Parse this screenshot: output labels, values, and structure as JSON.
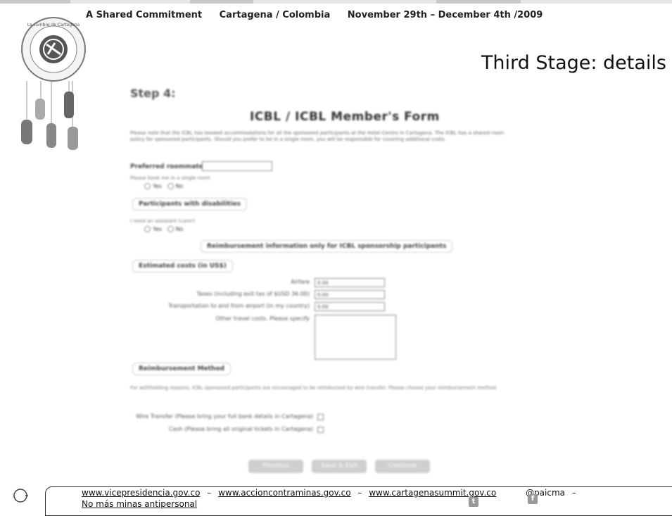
{
  "header": {
    "tagline": "A Shared Commitment",
    "location": "Cartagena / Colombia",
    "dates": "November 29th  – December 4th  /2009"
  },
  "slide": {
    "title": "Third Stage: details"
  },
  "logo": {
    "ring_text": "La cumbre de Cartagena por un mundo sin minas antipersonal"
  },
  "form": {
    "step": "Step 4:",
    "title": "ICBL / ICBL Member's Form",
    "intro": "Please note that the ICBL has booked accommodations for all the sponsored participants at the Hotel Centro in Cartagena. The ICBL has a shared room policy for sponsored participants. Should you prefer to be in a single room, you will be responsible for covering additional costs.",
    "preferred_roommate_label": "Preferred roommate",
    "single_room_question": "Please book me in a single room",
    "yes_label": "Yes",
    "no_label": "No",
    "disability_section": "Participants with disabilities",
    "assistant_question": "I need an assistant (carer)",
    "reimbursement_section": "Reimbursement information only for ICBL sponsorship participants",
    "estimated_costs_label": "Estimated costs (in US$)",
    "airfare_label": "Airfare",
    "taxes_label": "Taxes (including exit tax of $USD 36.00)",
    "transport_label": "Transportation to and from airport (in my country)",
    "other_costs_label": "Other travel costs. Please specify",
    "zero_value": "0.00",
    "method_section": "Reimbursement Method",
    "method_note": "For withholding reasons, ICBL sponsored participants are encouraged to be reimbursed by wire transfer. Please choose your reimbursement method",
    "wire_label": "Wire Transfer (Please bring your full bank details in Cartagena)",
    "cash_label": "Cash (Please bring all original tickets in Cartagena)",
    "buttons": [
      "Previous",
      "Save & Exit",
      "Continue"
    ]
  },
  "footer": {
    "links": [
      "www.vicepresidencia.gov.co",
      "www.accioncontraminas.gov.co",
      "www.cartagenasummit.gov.co"
    ],
    "handle": "@paicma",
    "slogan": "No más minas antipersonal",
    "dash": "–"
  }
}
